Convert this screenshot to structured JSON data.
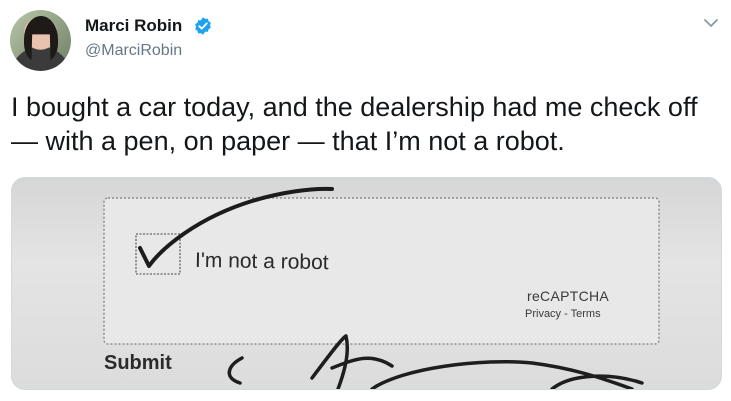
{
  "author": {
    "name": "Marci Robin",
    "handle": "@MarciRobin",
    "verified_icon": "verified-badge-icon",
    "avatar_icon": "profile-photo"
  },
  "menu": {
    "icon": "chevron-down-icon"
  },
  "tweet": {
    "text": "I bought a car today, and the dealership had me check off — with a pen, on paper — that I’m not a robot."
  },
  "photo": {
    "captcha_label": "I'm not a robot",
    "recaptcha_brand": "reCAPTCHA",
    "recaptcha_links": "Privacy - Terms",
    "submit_label": "Submit"
  },
  "colors": {
    "verified": "#1da1f2",
    "handle": "#657786",
    "text": "#14171a"
  }
}
